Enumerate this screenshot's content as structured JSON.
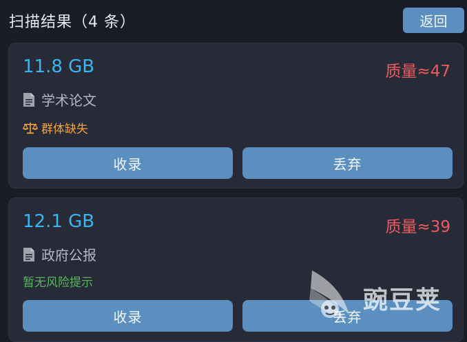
{
  "header": {
    "title": "扫描结果（4 条）",
    "back_label": "返回"
  },
  "cards": [
    {
      "size": "11.8 GB",
      "quality": "质量≈47",
      "category": "学术论文",
      "risk_icon": "scale-icon",
      "risk": "群体缺失",
      "keep_label": "收录",
      "drop_label": "丢弃"
    },
    {
      "size": "12.1 GB",
      "quality": "质量≈39",
      "category": "政府公报",
      "risk": "暂无风险提示",
      "keep_label": "收录",
      "drop_label": "丢弃"
    }
  ],
  "colors": {
    "background": "#1a1d28",
    "card": "#272b38",
    "accent_button": "#5b8fbf",
    "size_text": "#3db4ec",
    "quality_text": "#ee5b5f",
    "risk_warning": "#f2a33a",
    "risk_none": "#59b461"
  },
  "watermark": {
    "text": "豌豆荚"
  }
}
